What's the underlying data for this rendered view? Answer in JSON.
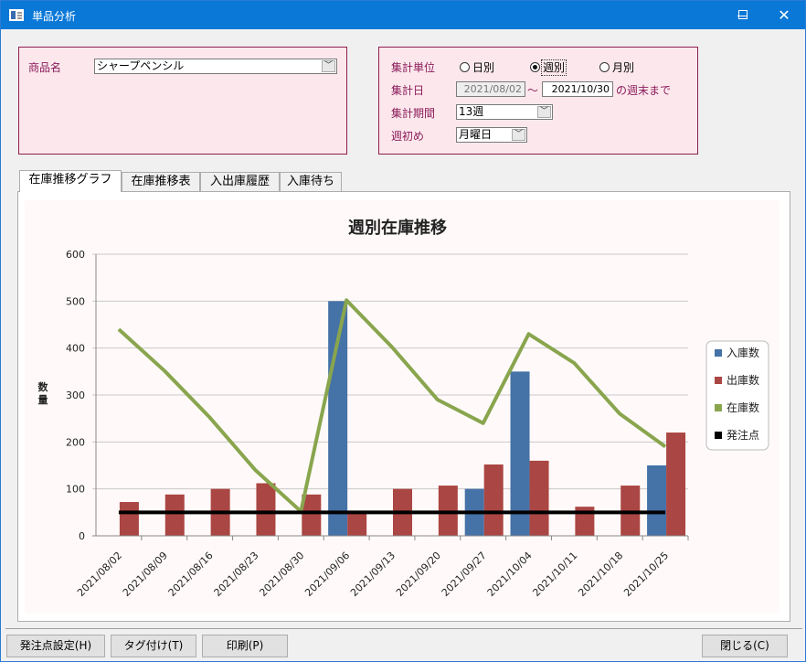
{
  "window": {
    "title": "単品分析"
  },
  "product": {
    "label": "商品名",
    "value": "シャープペンシル"
  },
  "agg": {
    "unit_label": "集計単位",
    "radios": [
      {
        "label": "日別",
        "checked": false
      },
      {
        "label": "週別",
        "checked": true
      },
      {
        "label": "月別",
        "checked": false
      }
    ],
    "date_label": "集計日",
    "date_from": "2021/08/02",
    "tilde": "～",
    "date_to": "2021/10/30",
    "date_suffix": "の週末まで",
    "period_label": "集計期間",
    "period_value": "13週",
    "weekstart_label": "週初め",
    "weekstart_value": "月曜日"
  },
  "tabs": [
    {
      "label": "在庫推移グラフ",
      "active": true
    },
    {
      "label": "在庫推移表",
      "active": false
    },
    {
      "label": "入出庫履歴",
      "active": false
    },
    {
      "label": "入庫待ち",
      "active": false
    }
  ],
  "buttons": {
    "reorder": "発注点設定(H)",
    "tag": "タグ付け(T)",
    "print": "印刷(P)",
    "close": "閉じる(C)"
  },
  "colors": {
    "inbound": "#4572a7",
    "outbound": "#aa4643",
    "stock": "#89a54e",
    "reorder": "#000000",
    "titlebar": "#0a78d7",
    "panel_border": "#8f1f4f"
  },
  "chart_data": {
    "type": "bar",
    "title": "週別在庫推移",
    "ylabel": "数量",
    "xlabel": "",
    "ylim": [
      0,
      600
    ],
    "yticks": [
      0,
      100,
      200,
      300,
      400,
      500,
      600
    ],
    "grid": true,
    "legend_position": "right",
    "categories": [
      "2021/08/02",
      "2021/08/09",
      "2021/08/16",
      "2021/08/23",
      "2021/08/30",
      "2021/09/06",
      "2021/09/13",
      "2021/09/20",
      "2021/09/27",
      "2021/10/04",
      "2021/10/11",
      "2021/10/18",
      "2021/10/25"
    ],
    "series": [
      {
        "name": "入庫数",
        "kind": "bar",
        "values": [
          0,
          0,
          0,
          0,
          0,
          500,
          0,
          0,
          100,
          350,
          0,
          0,
          150
        ]
      },
      {
        "name": "出庫数",
        "kind": "bar",
        "values": [
          72,
          88,
          100,
          112,
          88,
          50,
          100,
          107,
          152,
          160,
          62,
          107,
          220
        ]
      },
      {
        "name": "在庫数",
        "kind": "line",
        "values": [
          440,
          352,
          252,
          140,
          52,
          502,
          402,
          290,
          240,
          430,
          368,
          260,
          190
        ]
      },
      {
        "name": "発注点",
        "kind": "line",
        "values": [
          50,
          50,
          50,
          50,
          50,
          50,
          50,
          50,
          50,
          50,
          50,
          50,
          50
        ]
      }
    ]
  }
}
